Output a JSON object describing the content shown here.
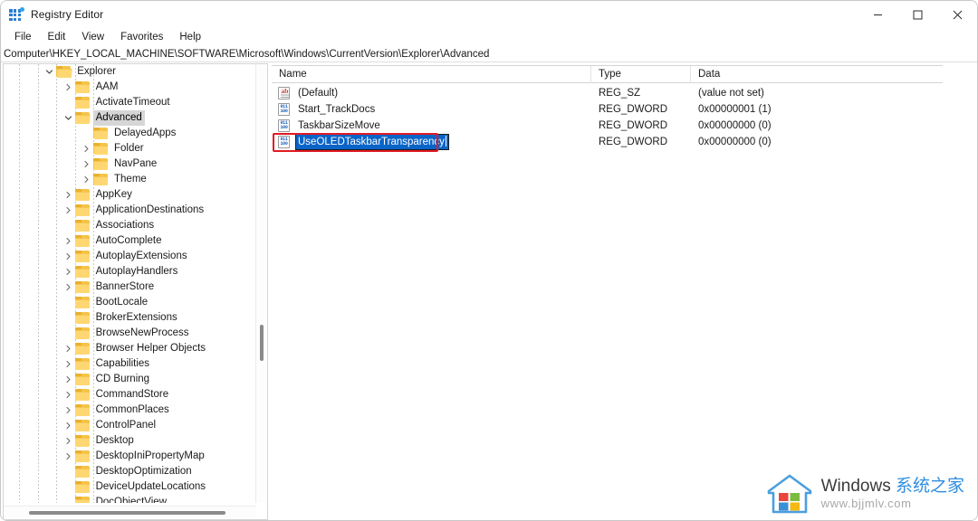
{
  "window": {
    "title": "Registry Editor",
    "icon": "registry-editor-icon",
    "controls": {
      "minimize": "minimize-button",
      "maximize": "maximize-button",
      "close": "close-button"
    }
  },
  "menubar": {
    "items": [
      {
        "label": "File"
      },
      {
        "label": "Edit"
      },
      {
        "label": "View"
      },
      {
        "label": "Favorites"
      },
      {
        "label": "Help"
      }
    ]
  },
  "address": {
    "path": "Computer\\HKEY_LOCAL_MACHINE\\SOFTWARE\\Microsoft\\Windows\\CurrentVersion\\Explorer\\Advanced"
  },
  "tree": {
    "items": [
      {
        "label": "Explorer",
        "depth": 3,
        "expander": "down",
        "selected": false
      },
      {
        "label": "AAM",
        "depth": 4,
        "expander": "right",
        "selected": false
      },
      {
        "label": "ActivateTimeout",
        "depth": 4,
        "expander": "none",
        "selected": false
      },
      {
        "label": "Advanced",
        "depth": 4,
        "expander": "down",
        "selected": true
      },
      {
        "label": "DelayedApps",
        "depth": 5,
        "expander": "none",
        "selected": false
      },
      {
        "label": "Folder",
        "depth": 5,
        "expander": "right",
        "selected": false
      },
      {
        "label": "NavPane",
        "depth": 5,
        "expander": "right",
        "selected": false
      },
      {
        "label": "Theme",
        "depth": 5,
        "expander": "right",
        "selected": false
      },
      {
        "label": "AppKey",
        "depth": 4,
        "expander": "right",
        "selected": false
      },
      {
        "label": "ApplicationDestinations",
        "depth": 4,
        "expander": "right",
        "selected": false
      },
      {
        "label": "Associations",
        "depth": 4,
        "expander": "none",
        "selected": false
      },
      {
        "label": "AutoComplete",
        "depth": 4,
        "expander": "right",
        "selected": false
      },
      {
        "label": "AutoplayExtensions",
        "depth": 4,
        "expander": "right",
        "selected": false
      },
      {
        "label": "AutoplayHandlers",
        "depth": 4,
        "expander": "right",
        "selected": false
      },
      {
        "label": "BannerStore",
        "depth": 4,
        "expander": "right",
        "selected": false
      },
      {
        "label": "BootLocale",
        "depth": 4,
        "expander": "none",
        "selected": false
      },
      {
        "label": "BrokerExtensions",
        "depth": 4,
        "expander": "none",
        "selected": false
      },
      {
        "label": "BrowseNewProcess",
        "depth": 4,
        "expander": "none",
        "selected": false
      },
      {
        "label": "Browser Helper Objects",
        "depth": 4,
        "expander": "right",
        "selected": false
      },
      {
        "label": "Capabilities",
        "depth": 4,
        "expander": "right",
        "selected": false
      },
      {
        "label": "CD Burning",
        "depth": 4,
        "expander": "right",
        "selected": false
      },
      {
        "label": "CommandStore",
        "depth": 4,
        "expander": "right",
        "selected": false
      },
      {
        "label": "CommonPlaces",
        "depth": 4,
        "expander": "right",
        "selected": false
      },
      {
        "label": "ControlPanel",
        "depth": 4,
        "expander": "right",
        "selected": false
      },
      {
        "label": "Desktop",
        "depth": 4,
        "expander": "right",
        "selected": false
      },
      {
        "label": "DesktopIniPropertyMap",
        "depth": 4,
        "expander": "right",
        "selected": false
      },
      {
        "label": "DesktopOptimization",
        "depth": 4,
        "expander": "none",
        "selected": false
      },
      {
        "label": "DeviceUpdateLocations",
        "depth": 4,
        "expander": "none",
        "selected": false
      },
      {
        "label": "DocObjectView",
        "depth": 4,
        "expander": "none",
        "selected": false
      }
    ]
  },
  "values": {
    "columns": [
      "Name",
      "Type",
      "Data"
    ],
    "rows": [
      {
        "name": "(Default)",
        "type": "REG_SZ",
        "data": "(value not set)",
        "icon": "string-value-icon",
        "editing": false,
        "annotated": false
      },
      {
        "name": "Start_TrackDocs",
        "type": "REG_DWORD",
        "data": "0x00000001 (1)",
        "icon": "dword-value-icon",
        "editing": false,
        "annotated": false
      },
      {
        "name": "TaskbarSizeMove",
        "type": "REG_DWORD",
        "data": "0x00000000 (0)",
        "icon": "dword-value-icon",
        "editing": false,
        "annotated": false
      },
      {
        "name": "UseOLEDTaskbarTransparency",
        "type": "REG_DWORD",
        "data": "0x00000000 (0)",
        "icon": "dword-value-icon",
        "editing": true,
        "annotated": true
      }
    ]
  },
  "watermark": {
    "brand_en": "Windows ",
    "brand_cn": "系统之家",
    "url": "www.bjjmlv.com"
  },
  "colors": {
    "annotation": "#e01b24",
    "selection": "#0a64c8",
    "tree_selection": "#d6d6d6",
    "folder": "#ffd772",
    "accent": "#2b7cd3"
  }
}
